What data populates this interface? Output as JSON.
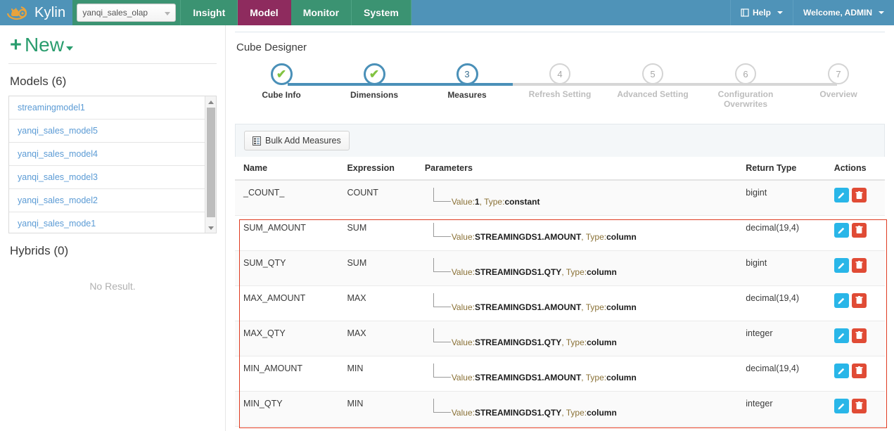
{
  "topnav": {
    "brand": "Kylin",
    "brand_logo_icon": "kylin-logo-icon",
    "project_select": {
      "value": "yanqi_sales_olap",
      "caret_icon": "caret-down-icon"
    },
    "tabs": [
      {
        "label": "Insight",
        "active": false
      },
      {
        "label": "Model",
        "active": true
      },
      {
        "label": "Monitor",
        "active": false
      },
      {
        "label": "System",
        "active": false
      }
    ],
    "help": {
      "label": "Help",
      "icon": "book-icon",
      "caret_icon": "caret-down-icon"
    },
    "user": {
      "label": "Welcome, ADMIN",
      "caret_icon": "caret-down-icon"
    }
  },
  "sidebar": {
    "new_button": {
      "plus": "+",
      "label": "New",
      "caret_icon": "caret-down-icon"
    },
    "models": {
      "title": "Models (6)",
      "items": [
        {
          "label": "streamingmodel1"
        },
        {
          "label": "yanqi_sales_model5"
        },
        {
          "label": "yanqi_sales_model4"
        },
        {
          "label": "yanqi_sales_model3"
        },
        {
          "label": "yanqi_sales_model2"
        },
        {
          "label": "yanqi_sales_mode1"
        }
      ]
    },
    "hybrids": {
      "title": "Hybrids (0)",
      "empty_text": "No Result."
    }
  },
  "main": {
    "panel_title": "Cube Designer",
    "steps": [
      {
        "num": "1",
        "label": "Cube Info",
        "state": "done"
      },
      {
        "num": "2",
        "label": "Dimensions",
        "state": "done"
      },
      {
        "num": "3",
        "label": "Measures",
        "state": "current"
      },
      {
        "num": "4",
        "label": "Refresh Setting",
        "state": "todo"
      },
      {
        "num": "5",
        "label": "Advanced Setting",
        "state": "todo"
      },
      {
        "num": "6",
        "label": "Configuration Overwrites",
        "state": "todo"
      },
      {
        "num": "7",
        "label": "Overview",
        "state": "todo"
      }
    ],
    "toolbar": {
      "bulk_add_label": "Bulk Add Measures",
      "bulk_add_icon": "list-add-icon"
    },
    "table": {
      "columns": [
        "Name",
        "Expression",
        "Parameters",
        "Return Type",
        "Actions"
      ],
      "rows": [
        {
          "name": "_COUNT_",
          "expression": "COUNT",
          "param_value_key": "Value:",
          "param_value": "1",
          "param_type_key": ", Type:",
          "param_type": "constant",
          "return_type": "bigint",
          "highlighted": false
        },
        {
          "name": "SUM_AMOUNT",
          "expression": "SUM",
          "param_value_key": "Value:",
          "param_value": "STREAMINGDS1.AMOUNT",
          "param_type_key": ", Type:",
          "param_type": "column",
          "return_type": "decimal(19,4)",
          "highlighted": true
        },
        {
          "name": "SUM_QTY",
          "expression": "SUM",
          "param_value_key": "Value:",
          "param_value": "STREAMINGDS1.QTY",
          "param_type_key": ", Type:",
          "param_type": "column",
          "return_type": "bigint",
          "highlighted": true
        },
        {
          "name": "MAX_AMOUNT",
          "expression": "MAX",
          "param_value_key": "Value:",
          "param_value": "STREAMINGDS1.AMOUNT",
          "param_type_key": ", Type:",
          "param_type": "column",
          "return_type": "decimal(19,4)",
          "highlighted": true
        },
        {
          "name": "MAX_QTY",
          "expression": "MAX",
          "param_value_key": "Value:",
          "param_value": "STREAMINGDS1.QTY",
          "param_type_key": ", Type:",
          "param_type": "column",
          "return_type": "integer",
          "highlighted": true
        },
        {
          "name": "MIN_AMOUNT",
          "expression": "MIN",
          "param_value_key": "Value:",
          "param_value": "STREAMINGDS1.AMOUNT",
          "param_type_key": ", Type:",
          "param_type": "column",
          "return_type": "decimal(19,4)",
          "highlighted": true
        },
        {
          "name": "MIN_QTY",
          "expression": "MIN",
          "param_value_key": "Value:",
          "param_value": "STREAMINGDS1.QTY",
          "param_type_key": ", Type:",
          "param_type": "column",
          "return_type": "integer",
          "highlighted": true
        }
      ],
      "action_icons": {
        "edit": "pencil-icon",
        "delete": "trash-icon"
      }
    }
  },
  "colors": {
    "header_blue": "#4f93b8",
    "nav_green": "#3b9372",
    "active_tab": "#8e2b5e",
    "step_blue": "#4a90b8",
    "check_green": "#82c341",
    "edit_blue": "#29b6e8",
    "delete_red": "#e04b35",
    "highlight_red": "#e03c22",
    "link_blue": "#5b9bd5",
    "new_green": "#2a9d6e"
  }
}
